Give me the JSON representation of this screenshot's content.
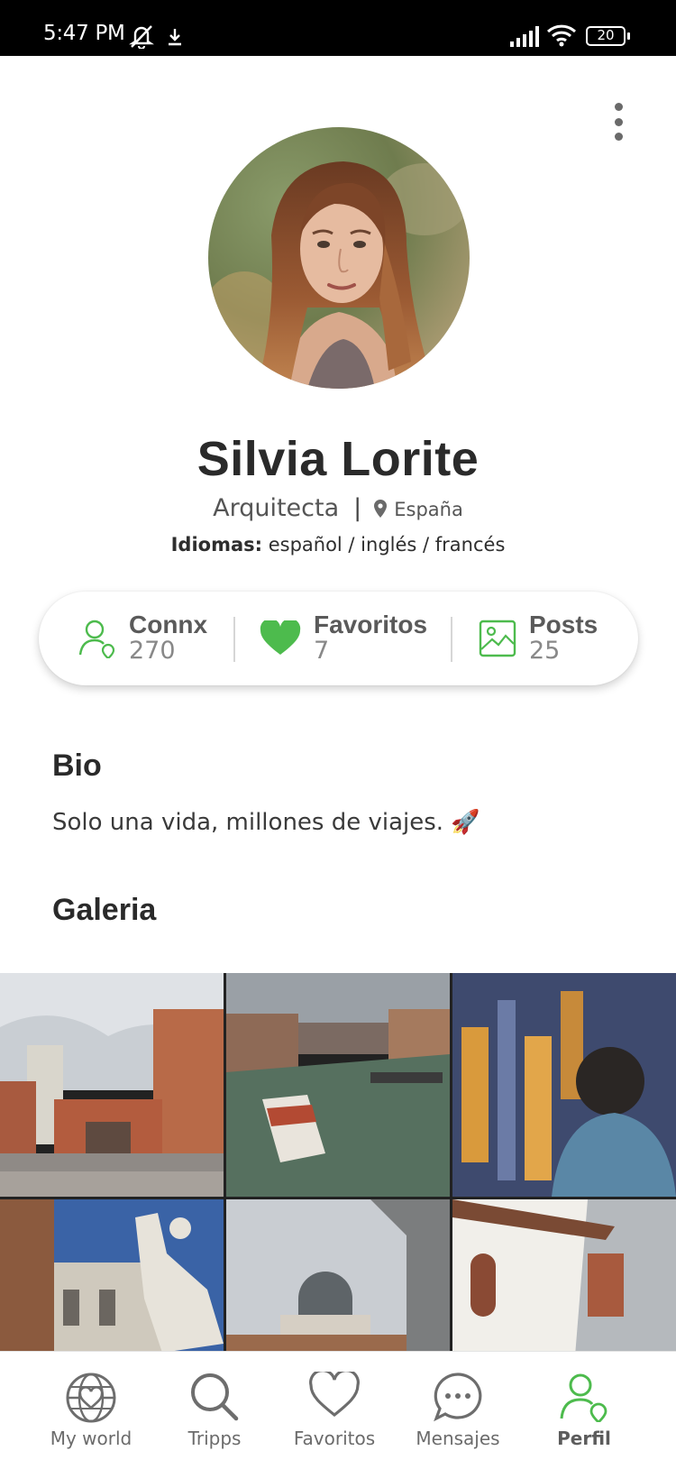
{
  "status_bar": {
    "time": "5:47 PM",
    "battery": "20"
  },
  "profile": {
    "name": "Silvia Lorite",
    "profession": "Arquitecta",
    "location": "España",
    "languages_label": "Idiomas:",
    "languages": "español / inglés / francés"
  },
  "stats": [
    {
      "label": "Connx",
      "value": "270",
      "icon": "user-pin-icon"
    },
    {
      "label": "Favoritos",
      "value": "7",
      "icon": "heart-icon"
    },
    {
      "label": "Posts",
      "value": "25",
      "icon": "image-icon"
    }
  ],
  "bio": {
    "title": "Bio",
    "text": "Solo una vida, millones de viajes. 🚀"
  },
  "gallery": {
    "title": "Galeria"
  },
  "nav": [
    {
      "label": "My world",
      "icon": "globe-heart-icon"
    },
    {
      "label": "Tripps",
      "icon": "search-icon"
    },
    {
      "label": "Favoritos",
      "icon": "heart-outline-icon"
    },
    {
      "label": "Mensajes",
      "icon": "chat-bubble-icon"
    },
    {
      "label": "Perfil",
      "icon": "user-pin-icon",
      "active": true
    }
  ],
  "colors": {
    "accent": "#4dbb4d",
    "icon_gray": "#6d6d6d",
    "text_dark": "#2a2a2a"
  }
}
